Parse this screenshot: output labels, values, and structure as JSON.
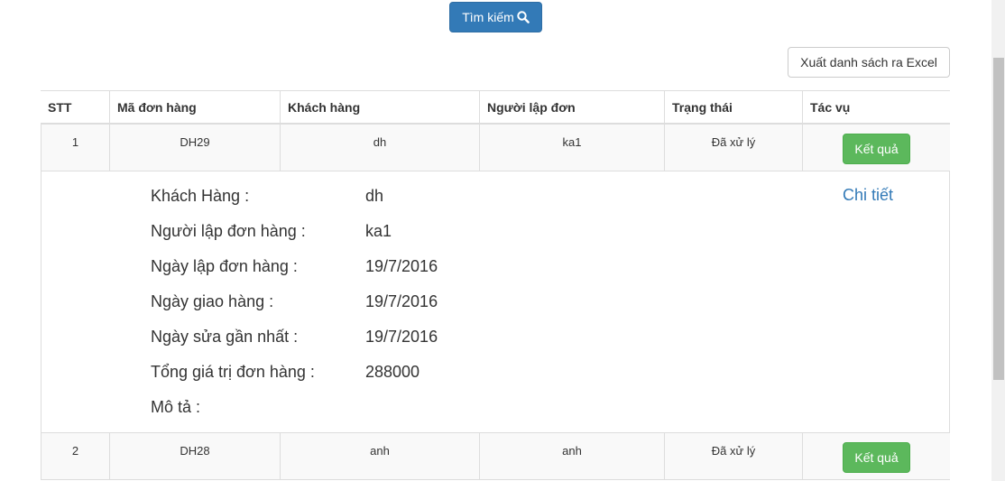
{
  "toolbar": {
    "search_label": "Tìm kiếm",
    "export_label": "Xuất danh sách ra Excel"
  },
  "table": {
    "headers": [
      "STT",
      "Mã đơn hàng",
      "Khách hàng",
      "Người lập đơn",
      "Trạng thái",
      "Tác vụ"
    ],
    "rows": [
      {
        "stt": "1",
        "ma": "DH29",
        "khach": "dh",
        "nguoi_lap": "ka1",
        "trang_thai": "Đã xử lý",
        "action": "Kết quả"
      },
      {
        "stt": "2",
        "ma": "DH28",
        "khach": "anh",
        "nguoi_lap": "anh",
        "trang_thai": "Đã xử lý",
        "action": "Kết quả"
      }
    ]
  },
  "detail": {
    "link": "Chi tiết",
    "items": [
      {
        "label": "Khách Hàng :",
        "value": "dh"
      },
      {
        "label": "Người lập đơn hàng :",
        "value": "ka1"
      },
      {
        "label": "Ngày lập đơn hàng :",
        "value": "19/7/2016"
      },
      {
        "label": "Ngày giao hàng :",
        "value": "19/7/2016"
      },
      {
        "label": "Ngày sửa gần nhất :",
        "value": "19/7/2016"
      },
      {
        "label": "Tổng giá trị đơn hàng :",
        "value": "288000"
      },
      {
        "label": "Mô tả :",
        "value": ""
      }
    ]
  },
  "colors": {
    "primary": "#337ab7",
    "success": "#5cb85c",
    "border": "#dddddd",
    "stripe": "#f9f9f9"
  }
}
